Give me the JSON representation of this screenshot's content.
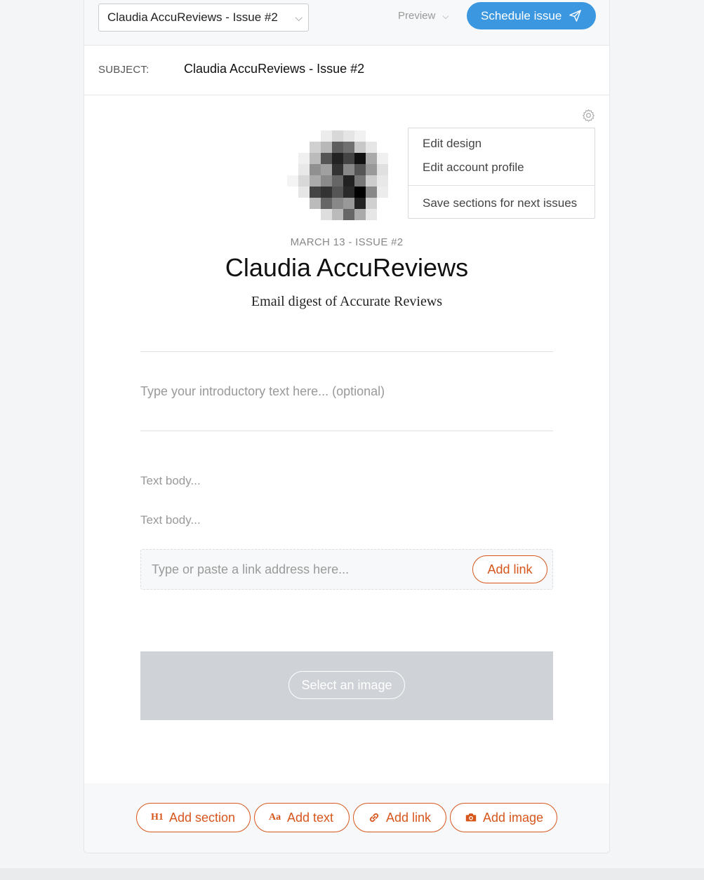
{
  "header": {
    "issue_select_value": "Claudia AccuReviews - Issue #2",
    "preview_label": "Preview",
    "schedule_label": "Schedule issue"
  },
  "subject": {
    "label": "SUBJECT:",
    "value": "Claudia AccuReviews - Issue #2"
  },
  "settings_menu": {
    "items": [
      "Edit design",
      "Edit account profile",
      "Save sections for next issues"
    ]
  },
  "newsletter": {
    "date_issue": "MARCH 13 - ISSUE #2",
    "title": "Claudia AccuReviews",
    "tagline": "Email digest of Accurate Reviews"
  },
  "content": {
    "intro_placeholder": "Type your introductory text here... (optional)",
    "text_body_1": "Text body...",
    "text_body_2": "Text body...",
    "link_placeholder": "Type or paste a link address here...",
    "link_add_label": "Add link",
    "select_image_label": "Select an image"
  },
  "footer": {
    "add_section": {
      "icon_text": "H1",
      "label": "Add section"
    },
    "add_text": {
      "icon_text": "Aa",
      "label": "Add text"
    },
    "add_link": {
      "icon": "link-icon",
      "label": "Add link"
    },
    "add_image": {
      "icon": "camera-icon",
      "label": "Add image"
    }
  },
  "colors": {
    "primary_blue": "#3a97e0",
    "accent_orange": "#d7561c"
  }
}
